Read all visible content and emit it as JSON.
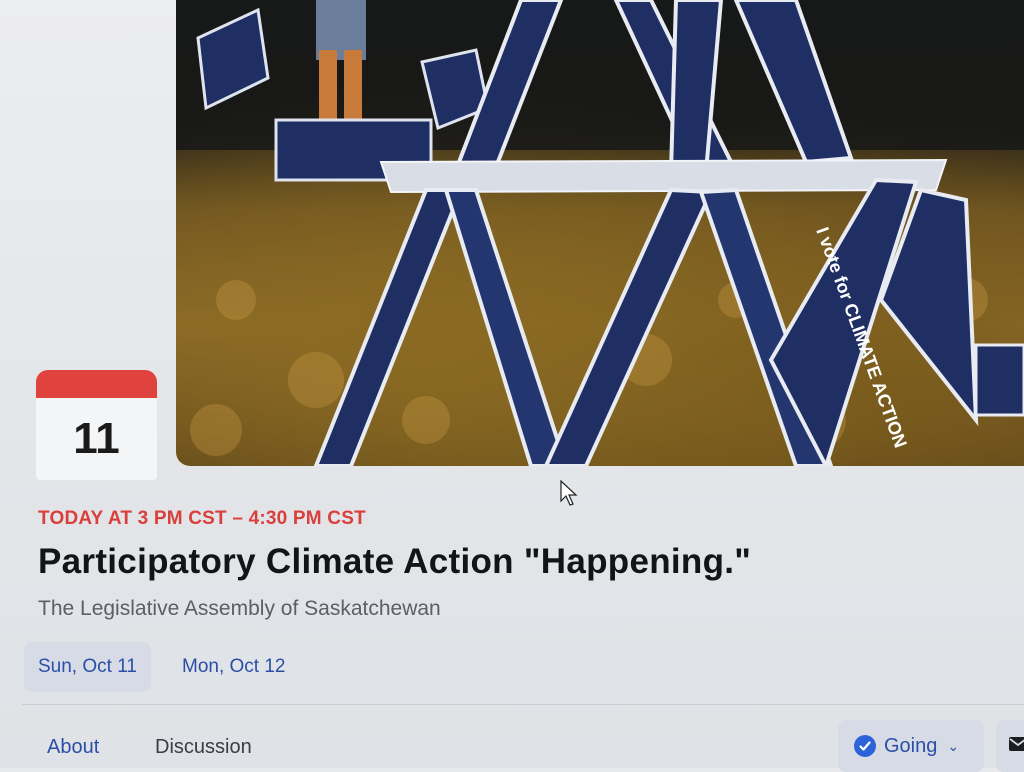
{
  "event": {
    "date_badge_day": "11",
    "time": "TODAY AT 3 PM CST – 4:30 PM CST",
    "title": "Participatory Climate Action \"Happening.\"",
    "location": "The Legislative Assembly of Saskatchewan"
  },
  "cover_photo": {
    "sign_text": "I vote for CLIMATE ACTION"
  },
  "date_chips": [
    {
      "label": "Sun, Oct 11",
      "selected": true
    },
    {
      "label": "Mon, Oct 12",
      "selected": false
    }
  ],
  "tabs": [
    {
      "label": "About",
      "active": true
    },
    {
      "label": "Discussion",
      "active": false
    }
  ],
  "actions": {
    "going_label": "Going",
    "going_icon": "check-circle-icon",
    "message_icon": "envelope-icon"
  },
  "colors": {
    "accent_red": "#d9403b",
    "link_blue": "#2b4fa7",
    "chip_bg": "#d6dbe6"
  }
}
